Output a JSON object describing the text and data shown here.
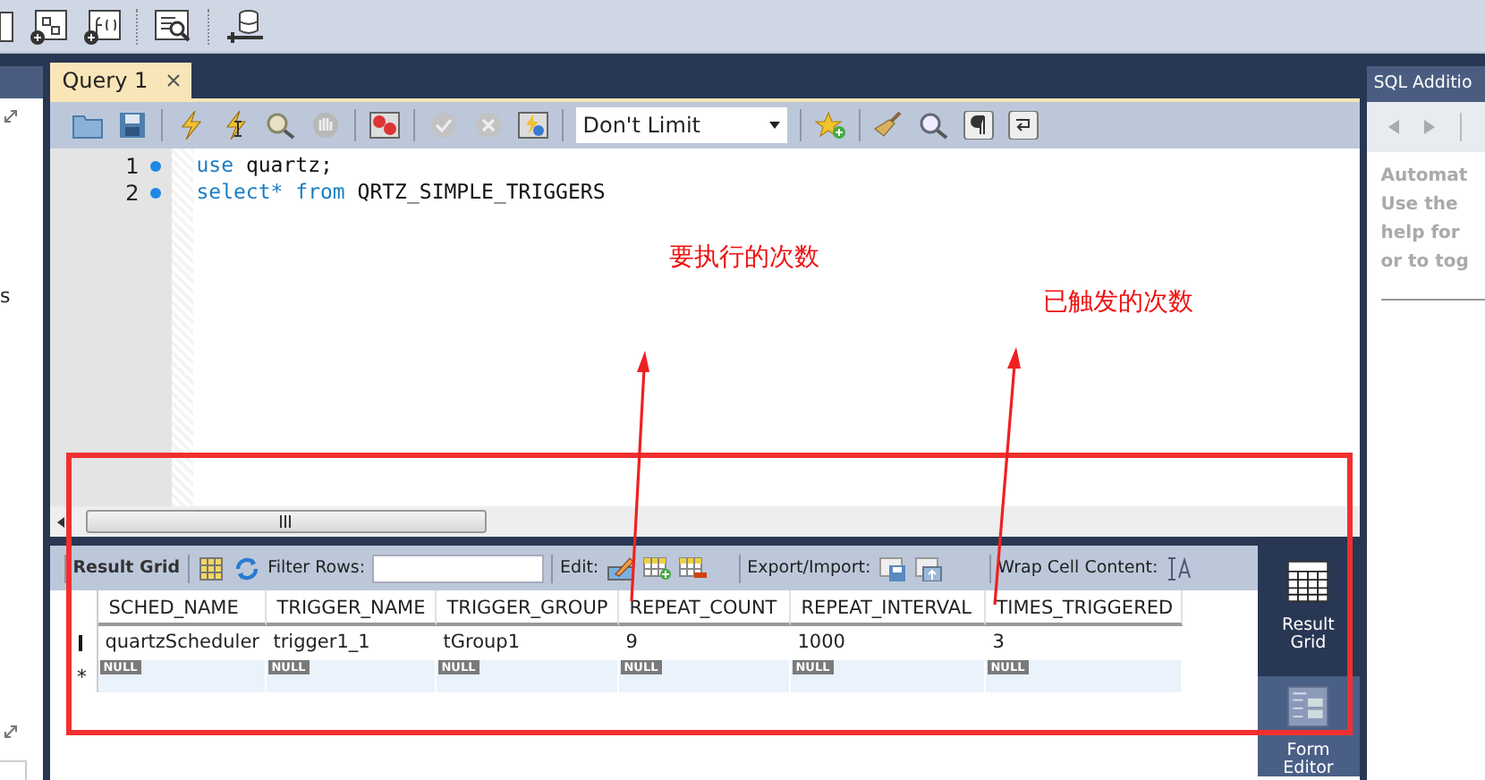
{
  "left_panel": {
    "fragment": "s"
  },
  "query_tab": {
    "label": "Query 1",
    "selected": true
  },
  "limit_select": {
    "value": "Don't Limit"
  },
  "editor": {
    "lines": [
      {
        "number": "1",
        "tokens": [
          {
            "kind": "keyword",
            "text": "use"
          },
          {
            "kind": "plain",
            "text": "quartz;"
          }
        ]
      },
      {
        "number": "2",
        "tokens": [
          {
            "kind": "keyword",
            "text": "select*"
          },
          {
            "kind": "keyword",
            "text": "from"
          },
          {
            "kind": "plain",
            "text": "QRTZ_SIMPLE_TRIGGERS"
          }
        ]
      }
    ]
  },
  "annotations": [
    {
      "text": "要执行的次数"
    },
    {
      "text": "已触发的次数"
    }
  ],
  "result_toolbar": {
    "title": "Result Grid",
    "filter_label": "Filter Rows:",
    "edit_label": "Edit:",
    "export_label": "Export/Import:",
    "wrap_label": "Wrap Cell Content:"
  },
  "grid": {
    "columns": [
      "SCHED_NAME",
      "TRIGGER_NAME",
      "TRIGGER_GROUP",
      "REPEAT_COUNT",
      "REPEAT_INTERVAL",
      "TIMES_TRIGGERED"
    ],
    "rows": [
      [
        "quartzScheduler",
        "trigger1_1",
        "tGroup1",
        "9",
        "1000",
        "3"
      ]
    ],
    "new_row": {
      "marker": "*",
      "cells": [
        "NULL",
        "NULL",
        "NULL",
        "NULL",
        "NULL",
        "NULL"
      ]
    }
  },
  "result_views": [
    {
      "label": "Result Grid",
      "selected": true
    },
    {
      "label": "Form Editor",
      "selected": false
    }
  ],
  "sql_additions": {
    "title": "SQL Additio",
    "help_lines": [
      "Automat",
      "Use the",
      "help for",
      "or to tog"
    ]
  }
}
